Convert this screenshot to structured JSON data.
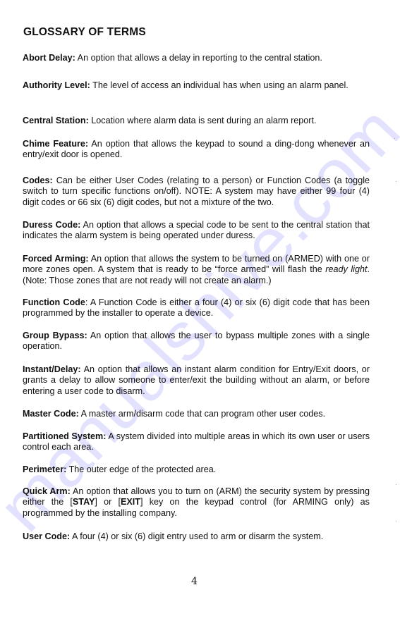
{
  "document": {
    "title": "GLOSSARY OF TERMS",
    "page_number": "4",
    "watermark": "manualshive.com",
    "watermark_color": "#3a3aff",
    "entries": [
      {
        "term": "Abort Delay:",
        "definition": " An option that allows a delay in reporting to the central station."
      },
      {
        "term": "Authority Level:",
        "definition": " The level of access an individual has when using an alarm panel."
      },
      {
        "term": "Central Station:",
        "definition": " Location where alarm data is sent during an alarm report."
      },
      {
        "term": "Chime Feature:",
        "definition": " An option that allows the keypad to sound a ding-dong whenever an entry/exit door is opened."
      },
      {
        "term": "Codes:",
        "definition": " Can be either User Codes (relating to a person) or Function Codes (a toggle switch to turn specific functions on/off).  NOTE: A system may have either 99 four (4) digit codes or 66 six (6) digit codes, but not a mixture of the two."
      },
      {
        "term": "Duress Code:",
        "definition": " An option that allows a special code to be sent to the central station that indicates the alarm system is being operated under duress."
      },
      {
        "term": "Forced Arming:",
        "definition": " An option that allows the system to be turned on (ARMED) with one or more zones open. A system that is ready to be “force armed” will flash the ",
        "italic": "ready light",
        "definition_after": ". (Note: Those zones that are not ready will not create an alarm.)"
      },
      {
        "term": "Function Code",
        "term_colon": ":",
        "definition": " A Function Code is either a four (4) or six (6) digit code that has been programmed by the installer to operate a device."
      },
      {
        "term": "Group Bypass:",
        "definition": " An option that allows the user to bypass multiple zones with a single operation."
      },
      {
        "term": "Instant/Delay:",
        "definition": " An option that allows an instant alarm condition for Entry/Exit doors, or grants a delay to allow someone to enter/exit the building without an alarm, or before entering a user code to disarm."
      },
      {
        "term": "Master Code:",
        "definition": " A master arm/disarm code that can program other user codes."
      },
      {
        "term": "Partitioned System:",
        "definition": " A system divided into multiple areas in which its own user or users control each area."
      },
      {
        "term": "Perimeter:",
        "definition": " The outer edge of the protected area."
      },
      {
        "term": "Quick Arm:",
        "definition": " An option that allows you to turn on (ARM) the security system by pressing either the [",
        "key1": "STAY",
        "mid": "] or [",
        "key2": "EXIT",
        "definition_after": "] key on the keypad control (for ARMING only) as programmed by the installing company."
      },
      {
        "term": "User Code:",
        "definition": " A four (4) or six (6) digit entry used to arm or disarm the system."
      }
    ]
  }
}
